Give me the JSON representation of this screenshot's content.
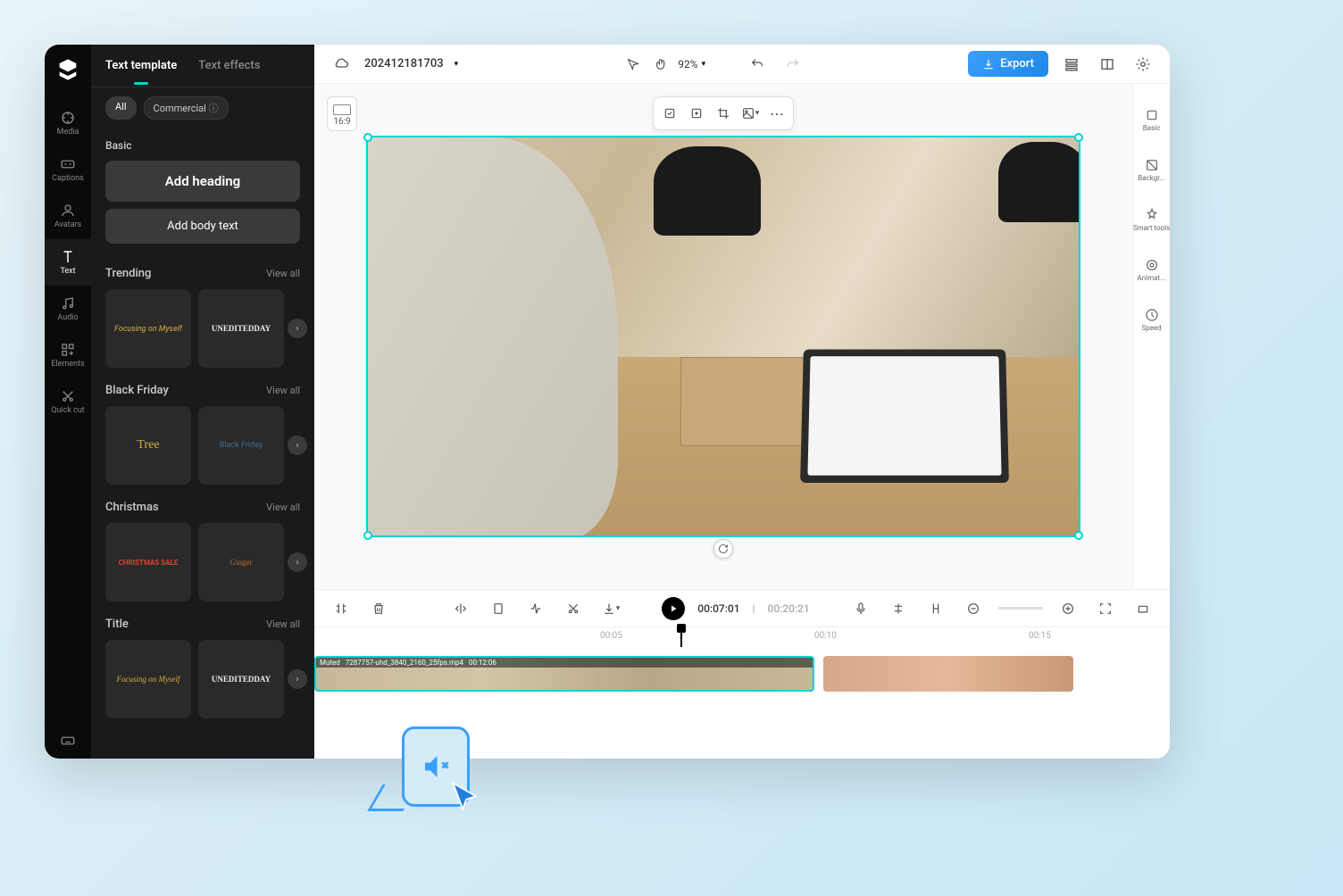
{
  "nav": {
    "items": [
      {
        "id": "media",
        "label": "Media"
      },
      {
        "id": "captions",
        "label": "Captions"
      },
      {
        "id": "avatars",
        "label": "Avatars"
      },
      {
        "id": "text",
        "label": "Text"
      },
      {
        "id": "audio",
        "label": "Audio"
      },
      {
        "id": "elements",
        "label": "Elements"
      },
      {
        "id": "quickcut",
        "label": "Quick cut"
      }
    ]
  },
  "panel": {
    "tabs": {
      "template": "Text template",
      "effects": "Text effects"
    },
    "chips": {
      "all": "All",
      "commercial": "Commercial"
    },
    "basic": {
      "title": "Basic",
      "heading": "Add heading",
      "body": "Add body text"
    },
    "sections": [
      {
        "title": "Trending",
        "view": "View all",
        "card1": "Focusing on Myself",
        "card2": "UNEDITEDDAY"
      },
      {
        "title": "Black Friday",
        "view": "View all",
        "card1": "Tree",
        "card2": "Black Friday"
      },
      {
        "title": "Christmas",
        "view": "View all",
        "card1": "CHRISTMAS SALE",
        "card2": "Ginger"
      },
      {
        "title": "Title",
        "view": "View all",
        "card1": "Focusing on Myself",
        "card2": "UNEDITEDDAY"
      }
    ]
  },
  "topbar": {
    "project": "202412181703",
    "zoom": "92%",
    "export": "Export"
  },
  "canvas": {
    "ratio": "16:9"
  },
  "rightRail": [
    {
      "label": "Basic"
    },
    {
      "label": "Backgr..."
    },
    {
      "label": "Smart tools"
    },
    {
      "label": "Animat..."
    },
    {
      "label": "Speed"
    }
  ],
  "timeline": {
    "current": "00:07:01",
    "total": "00:20:21",
    "ticks": [
      "00:05",
      "00:10",
      "00:15"
    ],
    "clip": {
      "muted": "Muted",
      "name": "7287757-uhd_3840_2160_25fps.mp4",
      "dur": "00:12:06"
    }
  }
}
